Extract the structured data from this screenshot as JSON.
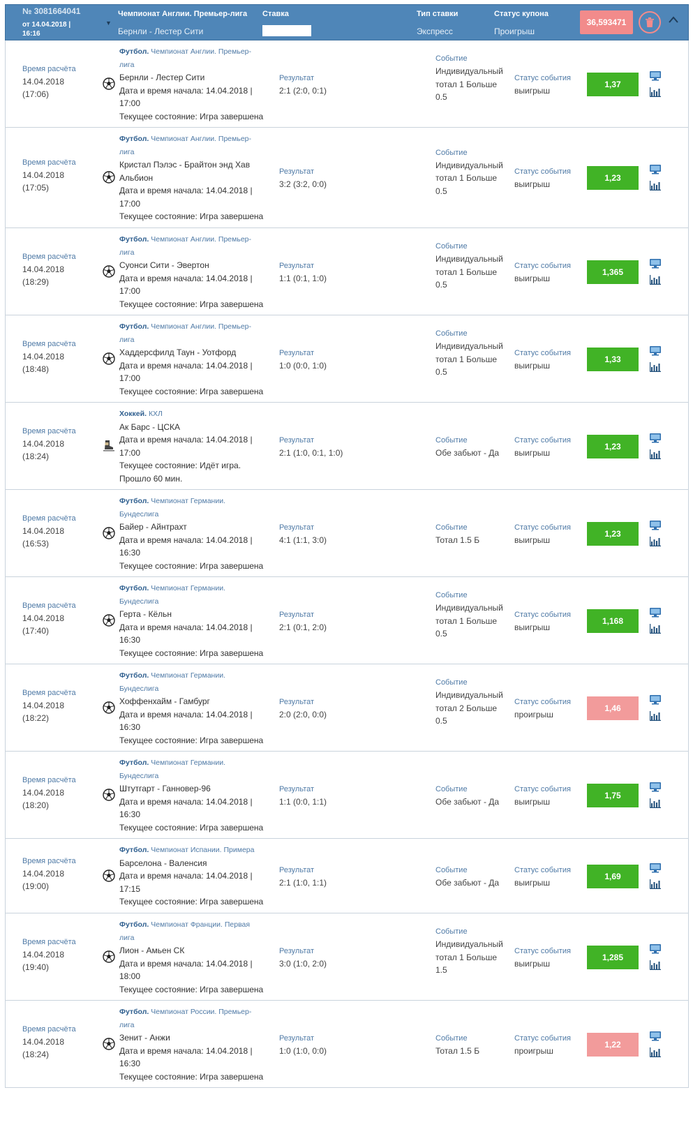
{
  "coupon": {
    "number": "№ 3081664041",
    "date": "от 14.04.2018 |",
    "time": "16:16",
    "league": "Чемпионат Англии. Премьер-лига",
    "match": "Бернли - Лестер Сити",
    "stake_label": "Ставка",
    "type_label": "Тип ставки",
    "type_value": "Экспресс",
    "status_label": "Статус купона",
    "status_value": "Проигрыш",
    "payout": "36,593471"
  },
  "labels": {
    "calc_time": "Время расчёта",
    "result": "Результат",
    "event": "Событие",
    "event_status": "Статус события"
  },
  "rows": [
    {
      "date": "14.04.2018",
      "time": "(17:06)",
      "sport": "Футбол.",
      "league1": "Чемпионат Англии. Премьер-",
      "league2": "лига",
      "match": [
        "Бернли - Лестер Сити"
      ],
      "start1": "Дата и время начала: 14.04.2018 |",
      "start2": "17:00",
      "state": [
        "Текущее состояние: Игра завершена"
      ],
      "result": "2:1 (2:0, 0:1)",
      "event": [
        "Индивидуальный",
        "тотал 1 Больше",
        "0.5"
      ],
      "status": "выигрыш",
      "odds": "1,37",
      "win": true
    },
    {
      "date": "14.04.2018",
      "time": "(17:05)",
      "sport": "Футбол.",
      "league1": "Чемпионат Англии. Премьер-",
      "league2": "лига",
      "match": [
        "Кристал Пэлэс - Брайтон энд Хав",
        "Альбион"
      ],
      "start1": "Дата и время начала: 14.04.2018 |",
      "start2": "17:00",
      "state": [
        "Текущее состояние: Игра завершена"
      ],
      "result": "3:2 (3:2, 0:0)",
      "event": [
        "Индивидуальный",
        "тотал 1 Больше",
        "0.5"
      ],
      "status": "выигрыш",
      "odds": "1,23",
      "win": true
    },
    {
      "date": "14.04.2018",
      "time": "(18:29)",
      "sport": "Футбол.",
      "league1": "Чемпионат Англии. Премьер-",
      "league2": "лига",
      "match": [
        "Суонси Сити - Эвертон"
      ],
      "start1": "Дата и время начала: 14.04.2018 |",
      "start2": "17:00",
      "state": [
        "Текущее состояние: Игра завершена"
      ],
      "result": "1:1 (0:1, 1:0)",
      "event": [
        "Индивидуальный",
        "тотал 1 Больше",
        "0.5"
      ],
      "status": "выигрыш",
      "odds": "1,365",
      "win": true
    },
    {
      "date": "14.04.2018",
      "time": "(18:48)",
      "sport": "Футбол.",
      "league1": "Чемпионат Англии. Премьер-",
      "league2": "лига",
      "match": [
        "Хаддерсфилд Таун - Уотфорд"
      ],
      "start1": "Дата и время начала: 14.04.2018 |",
      "start2": "17:00",
      "state": [
        "Текущее состояние: Игра завершена"
      ],
      "result": "1:0 (0:0, 1:0)",
      "event": [
        "Индивидуальный",
        "тотал 1 Больше",
        "0.5"
      ],
      "status": "выигрыш",
      "odds": "1,33",
      "win": true
    },
    {
      "date": "14.04.2018",
      "time": "(18:24)",
      "sport": "Хоккей.",
      "league1": "КХЛ",
      "league2": "",
      "match": [
        "Ак Барс - ЦСКА"
      ],
      "start1": "Дата и время начала: 14.04.2018 |",
      "start2": "17:00",
      "state": [
        "Текущее состояние: Идёт игра.",
        "Прошло 60 мин."
      ],
      "result": "2:1 (1:0, 0:1, 1:0)",
      "event": [
        "Обе забьют - Да"
      ],
      "status": "выигрыш",
      "odds": "1,23",
      "win": true
    },
    {
      "date": "14.04.2018",
      "time": "(16:53)",
      "sport": "Футбол.",
      "league1": "Чемпионат Германии.",
      "league2": "Бундеслига",
      "match": [
        "Байер - Айнтрахт"
      ],
      "start1": "Дата и время начала: 14.04.2018 |",
      "start2": "16:30",
      "state": [
        "Текущее состояние: Игра завершена"
      ],
      "result": "4:1 (1:1, 3:0)",
      "event": [
        "Тотал 1.5 Б"
      ],
      "status": "выигрыш",
      "odds": "1,23",
      "win": true
    },
    {
      "date": "14.04.2018",
      "time": "(17:40)",
      "sport": "Футбол.",
      "league1": "Чемпионат Германии.",
      "league2": "Бундеслига",
      "match": [
        "Герта - Кёльн"
      ],
      "start1": "Дата и время начала: 14.04.2018 |",
      "start2": "16:30",
      "state": [
        "Текущее состояние: Игра завершена"
      ],
      "result": "2:1 (0:1, 2:0)",
      "event": [
        "Индивидуальный",
        "тотал 1 Больше",
        "0.5"
      ],
      "status": "выигрыш",
      "odds": "1,168",
      "win": true
    },
    {
      "date": "14.04.2018",
      "time": "(18:22)",
      "sport": "Футбол.",
      "league1": "Чемпионат Германии.",
      "league2": "Бундеслига",
      "match": [
        "Хоффенхайм - Гамбург"
      ],
      "start1": "Дата и время начала: 14.04.2018 |",
      "start2": "16:30",
      "state": [
        "Текущее состояние: Игра завершена"
      ],
      "result": "2:0 (2:0, 0:0)",
      "event": [
        "Индивидуальный",
        "тотал 2 Больше",
        "0.5"
      ],
      "status": "проигрыш",
      "odds": "1,46",
      "win": false
    },
    {
      "date": "14.04.2018",
      "time": "(18:20)",
      "sport": "Футбол.",
      "league1": "Чемпионат Германии.",
      "league2": "Бундеслига",
      "match": [
        "Штутгарт - Ганновер-96"
      ],
      "start1": "Дата и время начала: 14.04.2018 |",
      "start2": "16:30",
      "state": [
        "Текущее состояние: Игра завершена"
      ],
      "result": "1:1 (0:0, 1:1)",
      "event": [
        "Обе забьют - Да"
      ],
      "status": "выигрыш",
      "odds": "1,75",
      "win": true
    },
    {
      "date": "14.04.2018",
      "time": "(19:00)",
      "sport": "Футбол.",
      "league1": "Чемпионат Испании. Примера",
      "league2": "",
      "match": [
        "Барселона - Валенсия"
      ],
      "start1": "Дата и время начала: 14.04.2018 |",
      "start2": "17:15",
      "state": [
        "Текущее состояние: Игра завершена"
      ],
      "result": "2:1 (1:0, 1:1)",
      "event": [
        "Обе забьют - Да"
      ],
      "status": "выигрыш",
      "odds": "1,69",
      "win": true
    },
    {
      "date": "14.04.2018",
      "time": "(19:40)",
      "sport": "Футбол.",
      "league1": "Чемпионат Франции. Первая",
      "league2": "лига",
      "match": [
        "Лион - Амьен СК"
      ],
      "start1": "Дата и время начала: 14.04.2018 |",
      "start2": "18:00",
      "state": [
        "Текущее состояние: Игра завершена"
      ],
      "result": "3:0 (1:0, 2:0)",
      "event": [
        "Индивидуальный",
        "тотал 1 Больше",
        "1.5"
      ],
      "status": "выигрыш",
      "odds": "1,285",
      "win": true
    },
    {
      "date": "14.04.2018",
      "time": "(18:24)",
      "sport": "Футбол.",
      "league1": "Чемпионат России. Премьер-",
      "league2": "лига",
      "match": [
        "Зенит - Анжи"
      ],
      "start1": "Дата и время начала: 14.04.2018 |",
      "start2": "16:30",
      "state": [
        "Текущее состояние: Игра завершена"
      ],
      "result": "1:0 (1:0, 0:0)",
      "event": [
        "Тотал 1.5 Б"
      ],
      "status": "проигрыш",
      "odds": "1,22",
      "win": false
    }
  ],
  "icons": {
    "soccer": "soccer-ball-icon",
    "hockey": "hockey-skate-icon",
    "tv": "tv-icon",
    "stats": "stats-icon",
    "trash": "trash-icon",
    "chevron": "chevron-up-icon"
  },
  "colors": {
    "header": "#4f86b8",
    "win": "#41b326",
    "lose": "#f29b9b",
    "accent": "#4f7aa6"
  }
}
